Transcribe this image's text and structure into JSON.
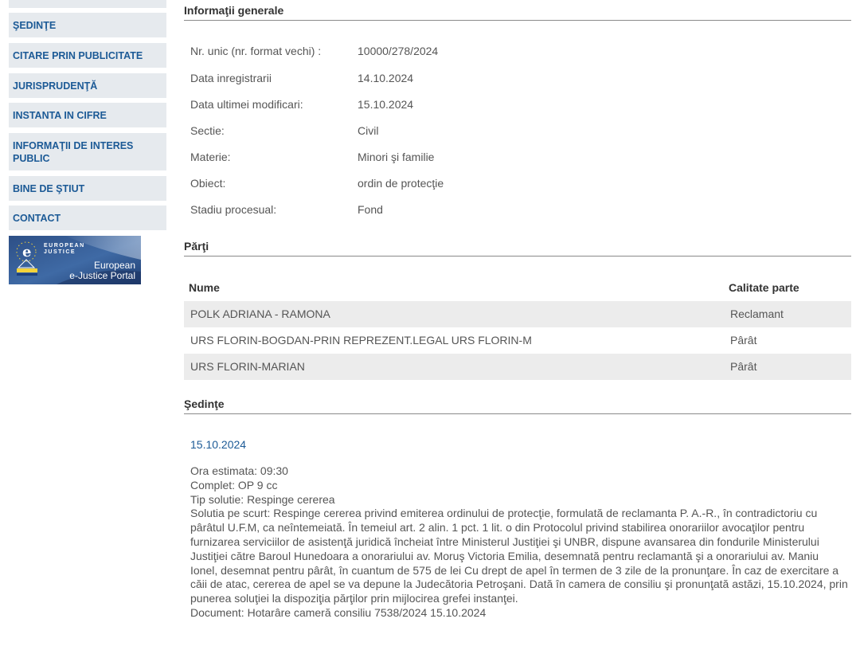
{
  "sidebar": {
    "items": [
      {
        "label": "ŞEDINŢE"
      },
      {
        "label": "CITARE PRIN PUBLICITATE"
      },
      {
        "label": "JURISPRUDENŢĂ"
      },
      {
        "label": "INSTANTA IN CIFRE"
      },
      {
        "label": "INFORMAŢII DE INTERES PUBLIC"
      },
      {
        "label": "BINE DE ŞTIUT"
      },
      {
        "label": "CONTACT"
      }
    ],
    "banner": {
      "line1": "European",
      "line2": "e-Justice Portal",
      "logo_top": "EUROPEAN",
      "logo_bottom": "JUSTICE"
    }
  },
  "general": {
    "title": "Informaţii generale",
    "rows": [
      {
        "label": "Nr. unic (nr. format vechi) :",
        "value": "10000/278/2024"
      },
      {
        "label": "Data inregistrarii",
        "value": "14.10.2024"
      },
      {
        "label": "Data ultimei modificari:",
        "value": "15.10.2024"
      },
      {
        "label": "Sectie:",
        "value": "Civil"
      },
      {
        "label": "Materie:",
        "value": "Minori şi familie"
      },
      {
        "label": "Obiect:",
        "value": "ordin de protecţie"
      },
      {
        "label": "Stadiu procesual:",
        "value": "Fond"
      }
    ]
  },
  "parties": {
    "title": "Părţi",
    "col_name": "Nume",
    "col_role": "Calitate parte",
    "rows": [
      {
        "name": "POLK ADRIANA - RAMONA",
        "role": "Reclamant"
      },
      {
        "name": "URS FLORIN-BOGDAN-PRIN REPREZENT.LEGAL URS FLORIN-M",
        "role": "Pârât"
      },
      {
        "name": "URS FLORIN-MARIAN",
        "role": "Pârât"
      }
    ]
  },
  "hearings": {
    "title": "Şedinţe",
    "date": "15.10.2024",
    "ora": "Ora estimata: 09:30",
    "complet": "Complet: OP 9 cc",
    "tip": "Tip solutie: Respinge cererea",
    "solutie": "Solutia pe scurt: Respinge cererea privind emiterea ordinului de protecţie, formulată de reclamanta P. A.-R., în contradictoriu cu pârâtul U.F.M, ca neîntemeiată. În temeiul art. 2 alin. 1 pct. 1 lit. o din Protocolul privind stabilirea onorariilor avocaţilor pentru furnizarea serviciilor de asistenţă juridică încheiat între Ministerul Justiţiei şi UNBR, dispune avansarea din fondurile Ministerului Justiţiei către Baroul Hunedoara a onorariului av. Moruş Victoria Emilia, desemnată pentru reclamantă şi a onorariului av. Maniu Ionel, desemnat pentru pârât, în cuantum de 575 de lei Cu drept de apel în termen de 3 zile de la pronunţare. În caz de exercitare a căii de atac, cererea de apel se va depune la Judecătoria Petroşani. Dată în camera de consiliu şi pronunţată astăzi, 15.10.2024, prin punerea soluţiei la dispoziţia părţilor prin mijlocirea grefei instanţei.",
    "document": "Document: Hotarâre cameră consiliu  7538/2024  15.10.2024"
  },
  "colors": {
    "link": "#1c5a96",
    "sidebar_bg": "#e6eaee",
    "row_shade": "#ececec"
  }
}
